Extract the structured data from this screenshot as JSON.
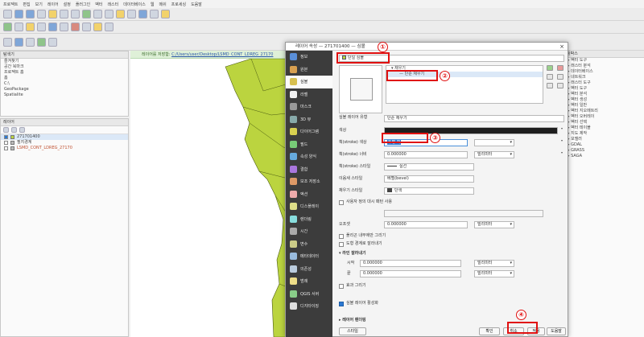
{
  "colors": {
    "polygon_fill": "#bbd43f",
    "polygon_stroke": "#4a5a10",
    "highlight": "#e01010",
    "sidebar_bg": "#3c3c3c",
    "color_bar": "#1e1e1e"
  },
  "menubar": [
    "프로젝트",
    "편집",
    "보기",
    "레이어",
    "설정",
    "플러그인",
    "벡터",
    "래스터",
    "데이터베이스",
    "웹",
    "메쉬",
    "프로세싱",
    "도움말"
  ],
  "left_panel": {
    "browser_title": "탐색기",
    "browser_items": [
      "즐겨찾기",
      "공간 북마크",
      "프로젝트 홈",
      "홈",
      "C:\\",
      "GeoPackage",
      "Spatialite"
    ],
    "layers_title": "레이어",
    "layers": [
      {
        "name": "271701400",
        "checked": true
      },
      {
        "name": "필지경계",
        "checked": false
      },
      {
        "name": "LSMD_CONT_LDREG_27170",
        "checked": false
      }
    ]
  },
  "message_bar": {
    "label": "레이어를 저장함:",
    "link": "C:/Users/user/Desktop/LSMD_CONT_LDREG_27170"
  },
  "right_panel": {
    "title": "툴박스",
    "items": [
      "벡터 도구",
      "래스터 분석",
      "데이터베이스",
      "네트워크",
      "래스터 도구",
      "벡터 도구",
      "벡터 분석",
      "벡터 생성",
      "벡터 일반",
      "벡터 지오메트리",
      "벡터 오버레이",
      "벡터 선택",
      "벡터 테이블",
      "지도 제작",
      "모델러",
      "GDAL",
      "GRASS",
      "SAGA"
    ]
  },
  "dialog": {
    "title": "레이어 속성 — 271701400 — 심볼",
    "symbol_type": "단일 심볼",
    "tree_root": "채우기",
    "tree_child": "단순 채우기",
    "sidebar": [
      "정보",
      "원본",
      "심볼",
      "라벨",
      "마스크",
      "3D 뷰",
      "다이어그램",
      "필드",
      "속성 양식",
      "결합",
      "보조 저장소",
      "액션",
      "디스플레이",
      "렌더링",
      "시간",
      "변수",
      "메타데이터",
      "의존성",
      "범례",
      "QGIS 서버",
      "디지타이징"
    ],
    "layer_type_label": "심볼 레이어 유형",
    "layer_type": "단순 채우기",
    "fields": {
      "fill_color_label": "색상",
      "stroke_color_label": "획(stroke) 색상",
      "stroke_color_value": "투명 획",
      "stroke_width_label": "획(stroke) 너비",
      "stroke_width_value": "0.000000",
      "stroke_width_unit": "밀리미터",
      "stroke_style_label": "획(stroke) 스타일",
      "stroke_style_value": "실선",
      "join_style_label": "이음새 스타일",
      "join_style_value": "베벨(bevel)",
      "fill_style_label": "채우기 스타일",
      "fill_style_value": "단색",
      "offset_label": "오프셋",
      "offset_x": "0.000000",
      "offset_y": "0.000000",
      "offset_unit": "밀리미터"
    },
    "checkboxes": {
      "custom_dash": "사용자 정의 대시 패턴 사용",
      "draw_inside": "폴리곤 내부에만 그리기",
      "clip": "도형 경계로 잘라내기",
      "draw_effects": "효과 그리기"
    },
    "section_trim": "라인 잘라내기",
    "trim_start_label": "시작",
    "trim_start_value": "0.000000",
    "trim_end_label": "끝",
    "trim_end_value": "0.000000",
    "trim_unit": "밀리미터",
    "enable_layer_label": "심볼 레이어 활성화",
    "layer_rendering": "레이어 렌더링",
    "buttons": {
      "style": "스타일",
      "ok": "확인",
      "cancel": "취소",
      "apply": "적용",
      "help": "도움말"
    }
  },
  "annotations": [
    "①",
    "②",
    "③",
    "④"
  ]
}
